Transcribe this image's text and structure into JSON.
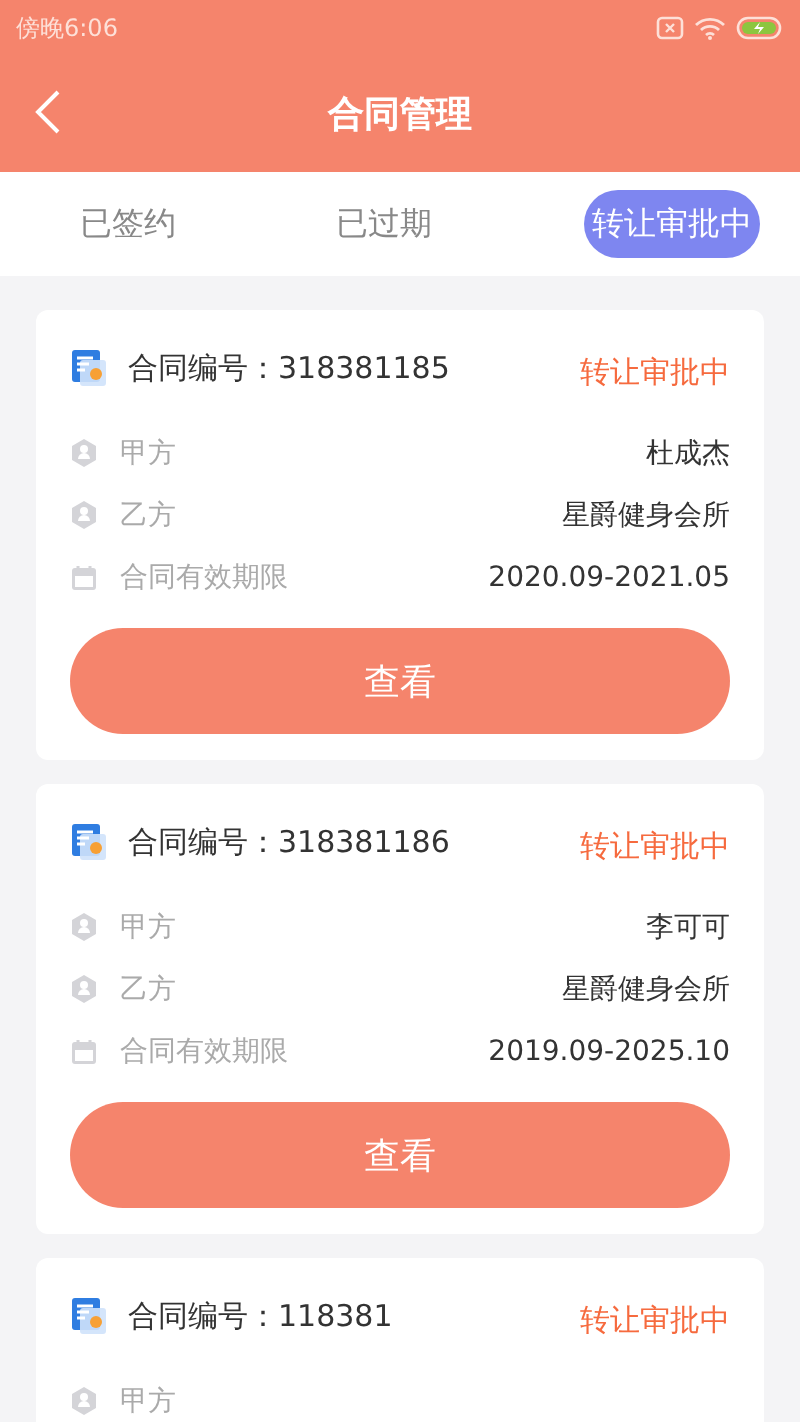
{
  "status_bar": {
    "time": "傍晚6:06"
  },
  "header": {
    "title": "合同管理"
  },
  "tabs": [
    {
      "label": "已签约",
      "selected": false
    },
    {
      "label": "已过期",
      "selected": false
    },
    {
      "label": "转让审批中",
      "selected": true
    }
  ],
  "contracts": [
    {
      "number": "合同编号：318381185",
      "status": "转让审批中",
      "fields": [
        {
          "kind": "party",
          "label": "甲方",
          "value": "杜成杰"
        },
        {
          "kind": "party",
          "label": "乙方",
          "value": "星爵健身会所"
        },
        {
          "kind": "period",
          "label": "合同有效期限",
          "value": "2020.09-2021.05"
        }
      ],
      "button": "查看"
    },
    {
      "number": "合同编号：318381186",
      "status": "转让审批中",
      "fields": [
        {
          "kind": "party",
          "label": "甲方",
          "value": "李可可"
        },
        {
          "kind": "party",
          "label": "乙方",
          "value": "星爵健身会所"
        },
        {
          "kind": "period",
          "label": "合同有效期限",
          "value": "2019.09-2025.10"
        }
      ],
      "button": "查看"
    },
    {
      "number": "合同编号：118381",
      "status": "转让审批中",
      "fields": [
        {
          "kind": "party",
          "label": "甲方"
        }
      ]
    }
  ]
}
